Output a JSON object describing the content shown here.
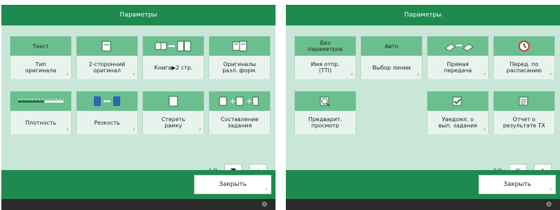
{
  "left": {
    "title": "Параметры",
    "tiles": [
      {
        "id": "text",
        "top_text": "Текст",
        "bottom_text": "Тип\nоригинала",
        "has_corner": true
      },
      {
        "id": "two-sided",
        "bottom_text": "2-сторонний\nоригинал",
        "has_corner": true
      },
      {
        "id": "book",
        "bottom_text": "Книга▶2 стр.",
        "has_corner": false
      },
      {
        "id": "different-sizes",
        "bottom_text": "Оригиналы\nразл. форм.",
        "has_corner": false
      },
      {
        "id": "density",
        "bottom_text": "Плотность",
        "has_corner": true
      },
      {
        "id": "sharpness",
        "bottom_text": "Резкость",
        "has_corner": true
      },
      {
        "id": "erase-frame",
        "bottom_text": "Стереть\nрамку",
        "has_corner": true
      },
      {
        "id": "job-build",
        "bottom_text": "Составление\nзадания",
        "has_corner": false
      }
    ],
    "pager": {
      "label": "1/2",
      "down": "▼",
      "up": "▲"
    },
    "close_label": "Закрыть"
  },
  "right": {
    "title": "Параметры",
    "tiles": [
      {
        "id": "no-params",
        "top_text": "Без\nпараметров",
        "bottom_text": "Имя отпр.\n(TTI)",
        "has_corner": true
      },
      {
        "id": "auto",
        "top_text": "Авто",
        "bottom_text": "Выбор линии",
        "has_corner": true
      },
      {
        "id": "direct-tx",
        "bottom_text": "Прямая\nпередача",
        "has_corner": true
      },
      {
        "id": "delayed",
        "bottom_text": "Перед. по\nрасписанию",
        "has_corner": true
      },
      {
        "id": "preview",
        "bottom_text": "Предварит.\nпросмотр",
        "has_corner": false
      },
      {
        "id": "job-notify",
        "bottom_text": "Уведомл. о\nвып. задания",
        "has_corner": true
      },
      {
        "id": "tx-report",
        "bottom_text": "Отчет о\nрезультате ТХ",
        "has_corner": false
      }
    ],
    "pager": {
      "label": "2/2",
      "down": "▼",
      "up": "▲"
    },
    "close_label": "Закрыть"
  },
  "colors": {
    "title_bar": "#1f8a4f",
    "panel_bg": "#c9e7d9",
    "tile_top": "#6bbf8f",
    "tile_bottom": "#e7f3ec",
    "status_bar": "#2b2b2b"
  },
  "icons": {
    "corner": "⌟",
    "status": "gear-sheet-icon"
  }
}
